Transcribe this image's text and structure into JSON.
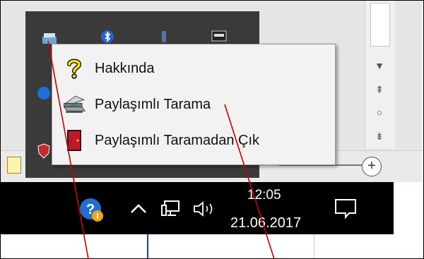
{
  "context_menu": {
    "items": [
      {
        "label": "Hakkında",
        "icon": "question-mark-icon"
      },
      {
        "label": "Paylaşımlı Tarama",
        "icon": "scanner-icon"
      },
      {
        "label": "Paylaşımlı Taramadan Çık",
        "icon": "exit-door-icon"
      }
    ]
  },
  "taskbar": {
    "time": "12:05",
    "date": "21.06.2017",
    "icons": [
      "help-icon",
      "chevron-up-icon",
      "network-icon",
      "volume-icon",
      "notification-icon"
    ]
  },
  "colors": {
    "taskbar": "#000000",
    "menu_bg": "#f2f2f2",
    "pointer_line": "#cc0000"
  }
}
